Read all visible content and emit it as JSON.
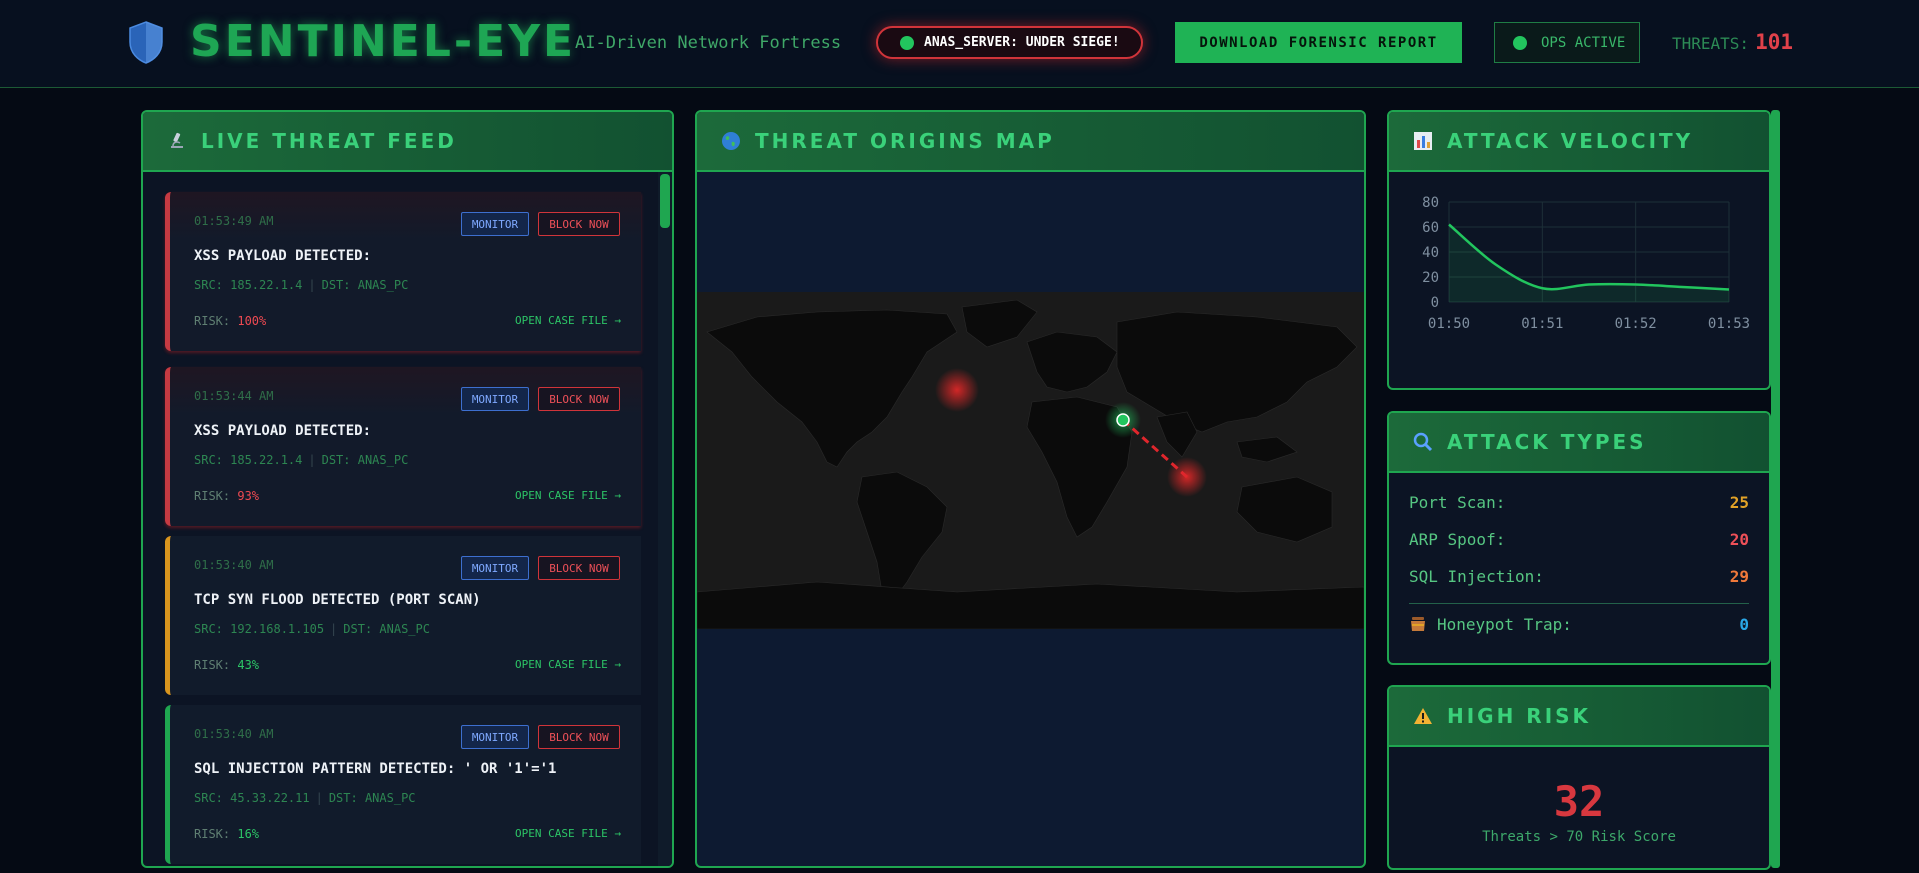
{
  "header": {
    "brand": "SENTINEL-EYE",
    "tagline": "AI-Driven Network Fortress",
    "status_badge": "ANAS_SERVER: UNDER SIEGE!",
    "download_label": "DOWNLOAD FORENSIC REPORT",
    "ops_label": "OPS ACTIVE",
    "threats_label": "THREATS:",
    "threats_count": "101"
  },
  "feed": {
    "title": "LIVE THREAT FEED",
    "monitor_label": "MONITOR",
    "block_label": "BLOCK NOW",
    "case_label": "OPEN CASE FILE →",
    "risk_label": "RISK:",
    "dst_value": "DST: ANAS_PC",
    "items": [
      {
        "time": "01:53:49 AM",
        "title": "XSS PAYLOAD DETECTED:",
        "src": "SRC: 185.22.1.4",
        "risk": "100%"
      },
      {
        "time": "01:53:44 AM",
        "title": "XSS PAYLOAD DETECTED:",
        "src": "SRC: 185.22.1.4",
        "risk": "93%"
      },
      {
        "time": "01:53:40 AM",
        "title": "TCP SYN FLOOD DETECTED (PORT SCAN)",
        "src": "SRC: 192.168.1.105",
        "risk": "43%"
      },
      {
        "time": "01:53:40 AM",
        "title": "SQL INJECTION PATTERN DETECTED: ' OR '1'='1",
        "src": "SRC: 45.33.22.11",
        "risk": "16%"
      }
    ]
  },
  "map": {
    "title": "THREAT ORIGINS MAP"
  },
  "velocity": {
    "title": "ATTACK VELOCITY"
  },
  "chart_data": {
    "type": "area",
    "title": "ATTACK VELOCITY",
    "x": [
      "01:50",
      "01:51",
      "01:52",
      "01:53"
    ],
    "y_ticks": [
      0,
      20,
      40,
      60,
      80
    ],
    "ylim": [
      0,
      80
    ],
    "series": [
      {
        "values_x": [
          0,
          0.5,
          1,
          1.5,
          2,
          2.5,
          3
        ],
        "values_y": [
          62,
          30,
          11,
          14,
          14,
          12,
          10
        ]
      }
    ],
    "grid": true,
    "color": "#22c55e"
  },
  "types": {
    "title": "ATTACK TYPES",
    "rows": [
      {
        "label": "Port Scan:",
        "value": "25",
        "color": "#e3a327"
      },
      {
        "label": "ARP Spoof:",
        "value": "20",
        "color": "#ee5058"
      },
      {
        "label": "SQL Injection:",
        "value": "29",
        "color": "#f0793a"
      }
    ],
    "honeypot": {
      "label": "Honeypot Trap:",
      "value": "0",
      "color": "#2aa7e6"
    }
  },
  "risk": {
    "title": "HIGH RISK",
    "value": "32",
    "label": "Threats > 70 Risk Score"
  }
}
